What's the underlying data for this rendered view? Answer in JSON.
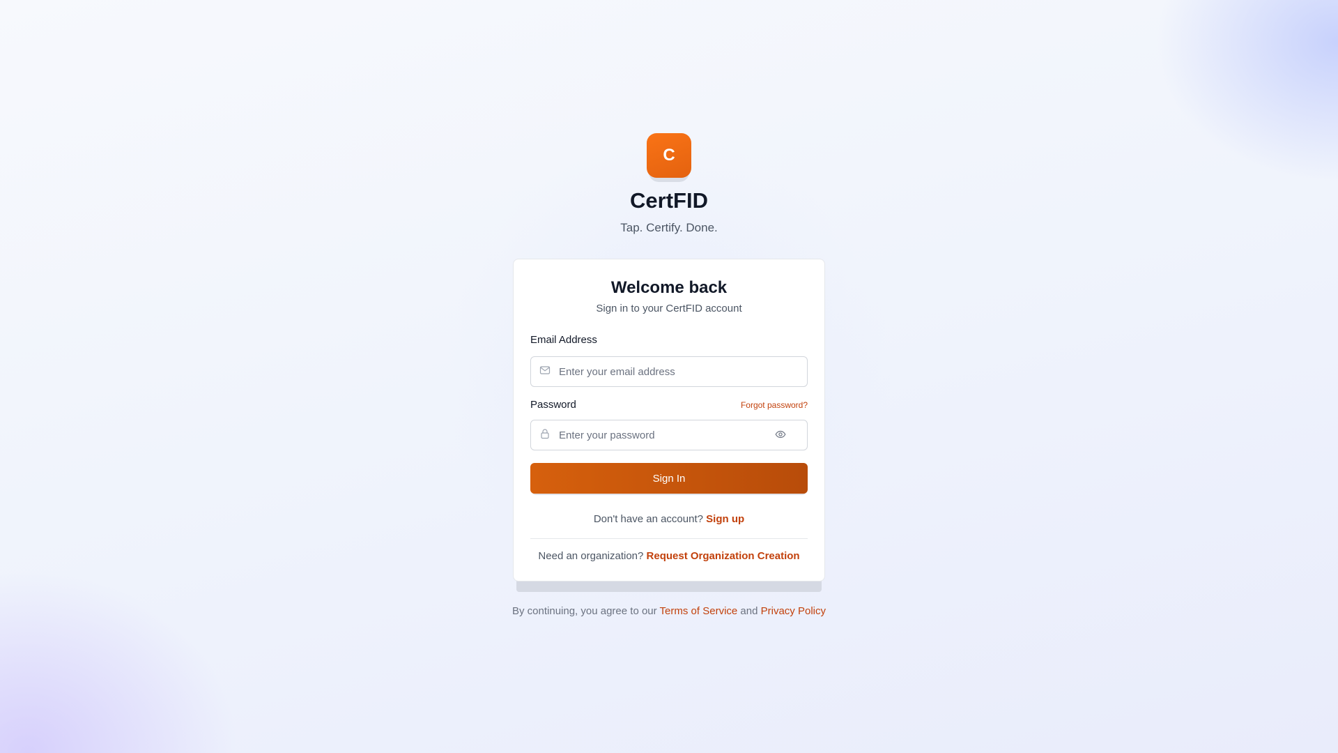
{
  "brand": {
    "logo_letter": "C",
    "name": "CertFID",
    "tagline": "Tap. Certify. Done.",
    "accent_color": "#ea580c"
  },
  "card": {
    "title": "Welcome back",
    "subtitle": "Sign in to your CertFID account"
  },
  "email": {
    "label": "Email Address",
    "placeholder": "Enter your email address",
    "value": "",
    "icon": "mail-icon"
  },
  "password": {
    "label": "Password",
    "forgot_label": "Forgot password?",
    "placeholder": "Enter your password",
    "value": "",
    "icon": "lock-icon",
    "toggle_icon": "eye-icon"
  },
  "sign_in_button": "Sign In",
  "signup": {
    "prompt": "Don't have an account?",
    "link": "Sign up"
  },
  "organization": {
    "prompt": "Need an organization?",
    "link": "Request Organization Creation"
  },
  "footer": {
    "prefix": "By continuing, you agree to our",
    "terms": "Terms of Service",
    "joiner": "and",
    "privacy": "Privacy Policy"
  }
}
